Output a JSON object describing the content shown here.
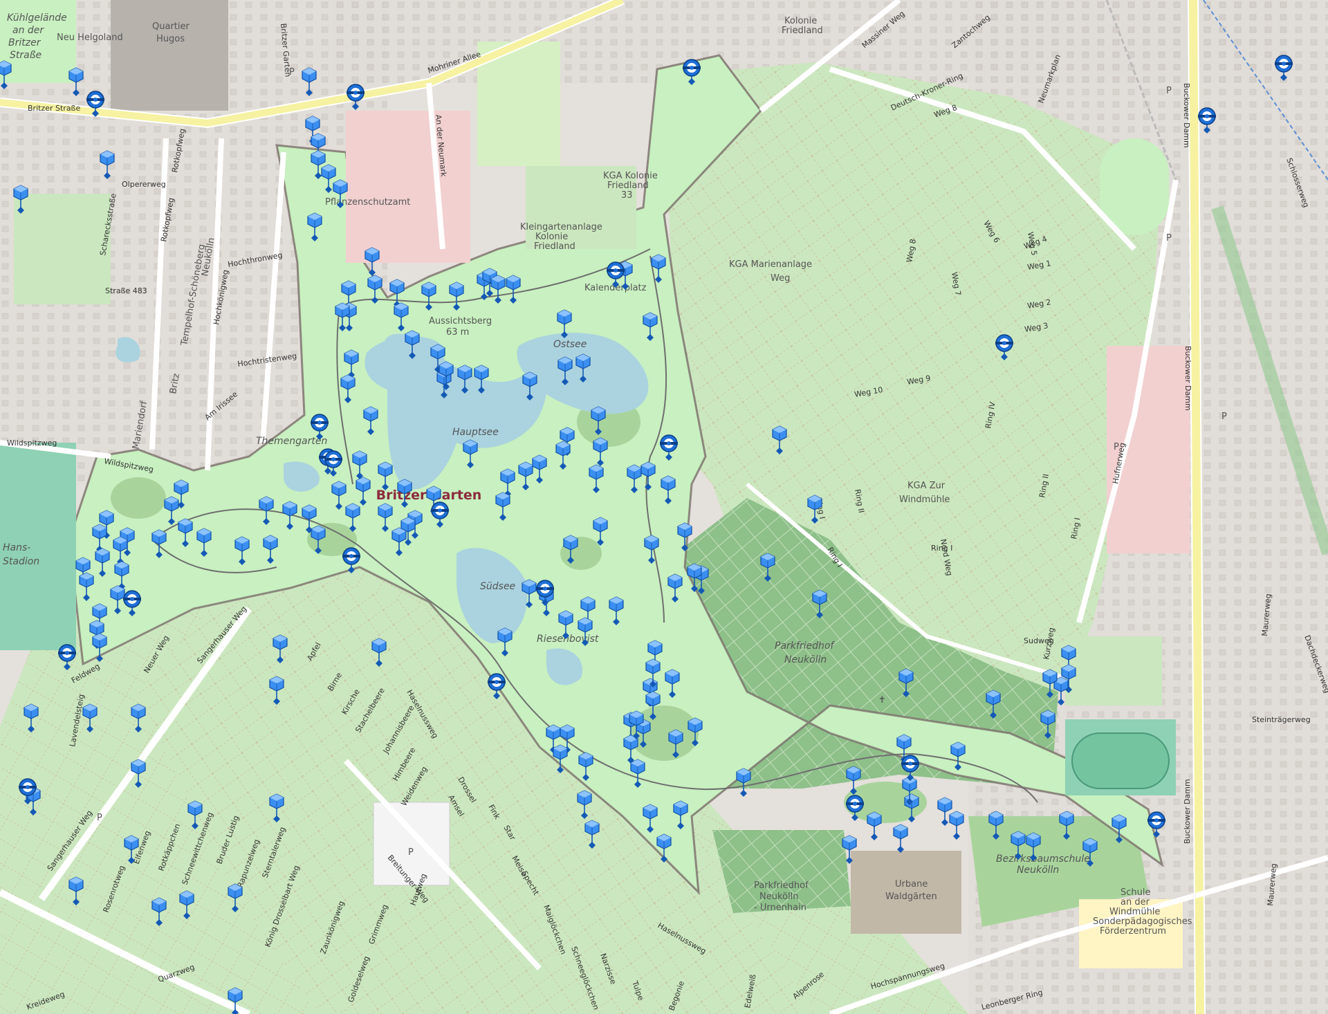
{
  "map": {
    "title": "Britzer Garten",
    "colors": {
      "background": "#f2efe9",
      "park": "#c8f0c0",
      "allotment": "#cbe7bf",
      "forest": "#a8d49c",
      "cemetery": "#8ec08a",
      "water": "#aad3df",
      "boundary": "#7a6e6a",
      "marker": "#1e6fd6",
      "primary_road": "#f6f2a1"
    }
  },
  "labels": {
    "place_main": "Britzer Garten",
    "park_labels": [
      "Hauptsee",
      "Ostsee",
      "Südsee",
      "Themengarten",
      "Aussichtsberg 63 m",
      "Kalenderplatz",
      "Riesenbovist",
      "Parkfriedhof Neukölln",
      "Parkfriedhof Neukölln - Urnenhain",
      "Urbane Waldgärten",
      "KGA Marienanlage Weg",
      "KGA Zur Windmühle",
      "KGA Kolonie Friedland 33",
      "Kleingartenanlage Kolonie Friedland II",
      "Kolonie Friedland",
      "Quartier Hugos",
      "Kühlgelände an der Britzer Straße",
      "Neu Helgoland",
      "Hans-Stadion",
      "Bezirksbaumschule Neukölln",
      "Schule an der Windmühle Sonderpädagogisches Förderzentrum",
      "Pflanzenschutzamt",
      "Tempelhof-Schöneberg",
      "Neukölln",
      "Mariendorf",
      "Britz"
    ],
    "streets": [
      "Britzer Straße",
      "Mohriner Allee",
      "Buckower Damm",
      "Massiner Weg",
      "Zantochweg",
      "Deutsch-Kroner-Ring",
      "Neumarkplan",
      "Schlosserweg",
      "Hufnerweg",
      "Maurerweg",
      "Steinträgerweg",
      "Dachdeckerweg",
      "Sangerhauser Weg",
      "Breitunger Weg",
      "Quarzweg",
      "Kreideweg",
      "Hochspannungsweg",
      "Leonberger Ring",
      "Alpenrose",
      "Edelweiß",
      "Begonie",
      "Tulpe",
      "Narzisse",
      "Schneeglöckchen",
      "Maiglöckchen",
      "Haselnussweg",
      "Fink",
      "Star",
      "Specht",
      "Meise",
      "Drossel",
      "Amsel",
      "Apfel",
      "Birne",
      "Kirsche",
      "Stachelbeere",
      "Johannisbeere",
      "Himbeere",
      "Weidenweg",
      "Feldweg",
      "Neuer Weg",
      "Lavendelsteig",
      "Olpererweg",
      "Rotkopfweg",
      "Hochthronweg",
      "Hochkönigweg",
      "Hochtristenweg",
      "Am Irissee",
      "Wildspitzweg",
      "Scharecksstraße",
      "Straße 483",
      "Sudweg",
      "Ring I",
      "Ring II",
      "Ring IV",
      "Weg 1",
      "Weg 2",
      "Weg 3",
      "Weg 4",
      "Weg 5",
      "Weg 6",
      "Weg 7",
      "Weg 8",
      "Weg 9",
      "Weg 10",
      "Nord Weg",
      "Grimmweg",
      "Goldeselweg",
      "Zaunkönigweg",
      "Haufweg",
      "Bruder Lustig",
      "König Drosselbart Weg",
      "Sterntalerweg",
      "Rapunzelweg",
      "Schneewittchenweg",
      "Rotkäppchen",
      "Elfenweg",
      "Rosenrotweg",
      "An der Neumark",
      "Britzer Garten",
      "Kurzweg"
    ],
    "parking": "P",
    "cemetery_symbol": "✝"
  },
  "markers": {
    "cube_count": 166,
    "ring_count": 21
  }
}
